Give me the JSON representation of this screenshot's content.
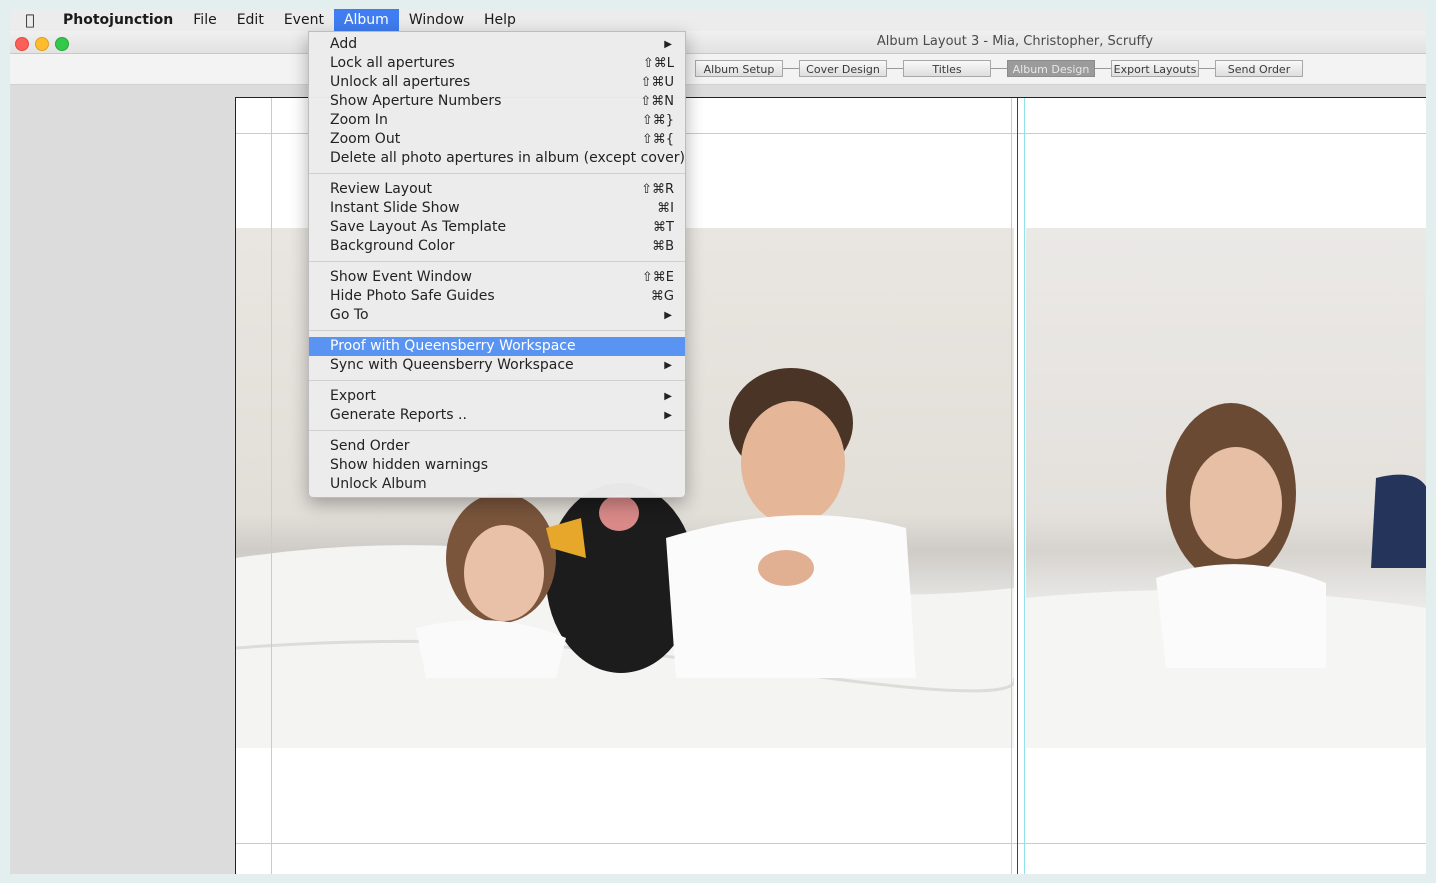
{
  "menubar": {
    "app_name": "Photojunction",
    "items": [
      "File",
      "Edit",
      "Event",
      "Album",
      "Window",
      "Help"
    ],
    "active_item": "Album",
    "apple_icon": "apple-logo-icon"
  },
  "window": {
    "title": "Album Layout 3 - Mia, Christopher, Scruffy"
  },
  "workflow": {
    "steps": [
      "Album Setup",
      "Cover Design",
      "Titles",
      "Album Design",
      "Export Layouts",
      "Send Order"
    ],
    "current": "Album Design"
  },
  "album_menu": {
    "groups": [
      [
        {
          "label": "Add",
          "submenu": true
        },
        {
          "label": "Lock all apertures",
          "shortcut": "⇧⌘L"
        },
        {
          "label": "Unlock all apertures",
          "shortcut": "⇧⌘U"
        },
        {
          "label": "Show Aperture Numbers",
          "shortcut": "⇧⌘N"
        },
        {
          "label": "Zoom In",
          "shortcut": "⇧⌘}"
        },
        {
          "label": "Zoom Out",
          "shortcut": "⇧⌘{"
        },
        {
          "label": "Delete all photo apertures in album (except cover)"
        }
      ],
      [
        {
          "label": "Review Layout",
          "shortcut": "⇧⌘R"
        },
        {
          "label": "Instant Slide Show",
          "shortcut": "⌘I"
        },
        {
          "label": "Save Layout As Template",
          "shortcut": "⌘T"
        },
        {
          "label": "Background Color",
          "shortcut": "⌘B"
        }
      ],
      [
        {
          "label": "Show Event Window",
          "shortcut": "⇧⌘E"
        },
        {
          "label": "Hide Photo Safe Guides",
          "shortcut": "⌘G"
        },
        {
          "label": "Go To",
          "submenu": true
        }
      ],
      [
        {
          "label": "Proof with Queensberry Workspace",
          "highlighted": true
        },
        {
          "label": "Sync with Queensberry Workspace",
          "submenu": true
        }
      ],
      [
        {
          "label": "Export",
          "submenu": true
        },
        {
          "label": "Generate Reports ..",
          "submenu": true
        }
      ],
      [
        {
          "label": "Send Order"
        },
        {
          "label": "Show hidden warnings"
        },
        {
          "label": "Unlock Album"
        }
      ]
    ]
  },
  "colors": {
    "menu_highlight": "#5a94f2",
    "menubar_active": "#3f7df0",
    "safe_guide": "#8fe3ec"
  }
}
